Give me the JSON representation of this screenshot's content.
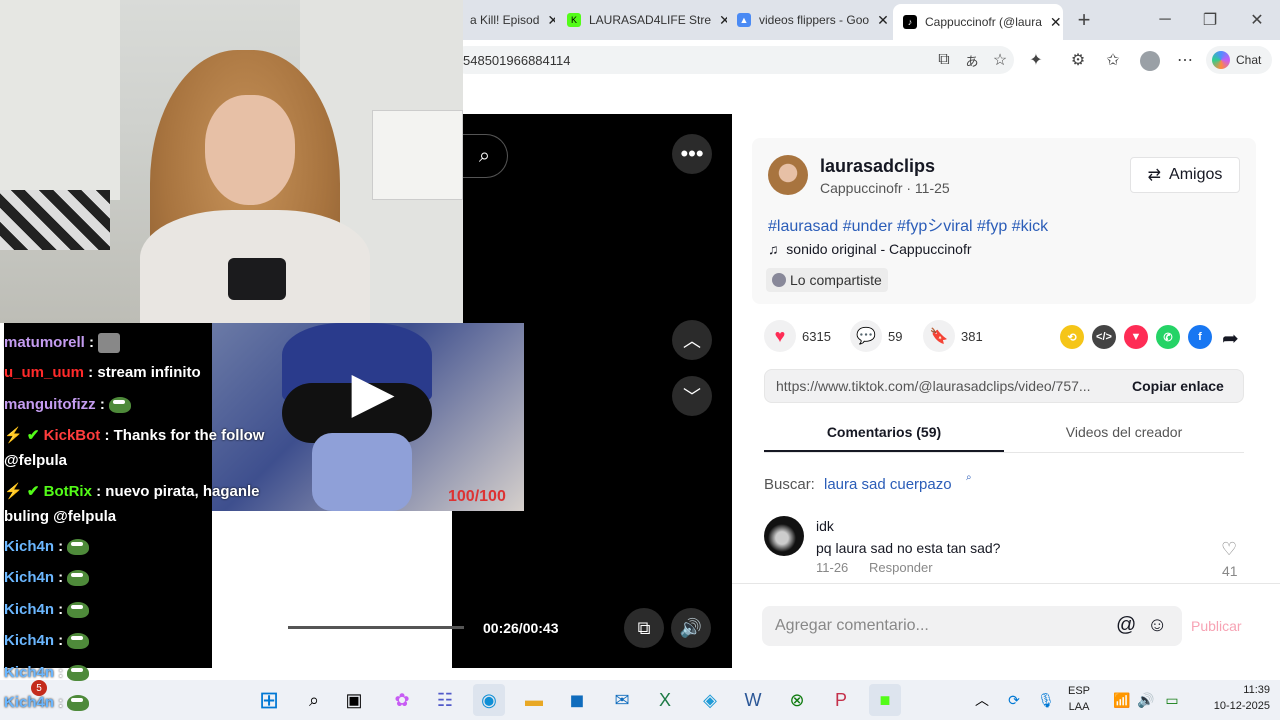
{
  "tabs": [
    {
      "label": "a Kill! Episod",
      "close": "✕"
    },
    {
      "label": "LAURASAD4LIFE Stre",
      "close": "✕"
    },
    {
      "label": "videos flippers - Goo",
      "close": "✕"
    },
    {
      "label": "Cappuccinofr (@laura",
      "close": "✕"
    }
  ],
  "browser": {
    "url": "548501966884114",
    "chat_label": "Chat",
    "new_tab": "+"
  },
  "post": {
    "username": "laurasadclips",
    "subline": "Cappuccinofr · 11-25",
    "friends_button": "Amigos",
    "hashtags": "#laurasad #under #fypシviral #fyp #kick",
    "sound": "sonido original - Cappuccinofr",
    "shared": "Lo compartiste",
    "likes": "6315",
    "comments": "59",
    "saves": "381",
    "link": "https://www.tiktok.com/@laurasadclips/video/757...",
    "copy_link": "Copiar enlace",
    "tab_comments": "Comentarios (59)",
    "tab_creator": "Videos del creador",
    "search_prefix": "Buscar:",
    "search_term": "laura sad cuerpazo",
    "comment": {
      "user": "idk",
      "text": "pq laura sad no esta tan sad?",
      "date": "11-26",
      "reply": "Responder",
      "likes": "41"
    },
    "add_comment_placeholder": "Agregar comentario...",
    "publish": "Publicar"
  },
  "video": {
    "time": "00:26/00:43",
    "progress": 0.6,
    "overlay_counter": "100/100"
  },
  "chat": [
    {
      "user": "matumorell",
      "text": "",
      "color": "#c49cf0",
      "emote": "avatar"
    },
    {
      "user": "u_um_uum",
      "text": "stream infinito",
      "color": "#ff2a2a"
    },
    {
      "user": "manguitofizz",
      "text": "",
      "color": "#c49cf0",
      "emote": "pepe"
    },
    {
      "user": "KickBot",
      "text": "Thanks for the follow",
      "color": "#ff3d3d",
      "text2": "@felpula"
    },
    {
      "user": "BotRix",
      "text": "nuevo pirata, haganle",
      "color": "#53fc18",
      "text2": "buling @felpula"
    },
    {
      "user": "Kich4n",
      "text": "",
      "color": "#6bb7ff",
      "emote": "pepe"
    },
    {
      "user": "Kich4n",
      "text": "",
      "color": "#6bb7ff",
      "emote": "pepe"
    },
    {
      "user": "Kich4n",
      "text": "",
      "color": "#6bb7ff",
      "emote": "pepe"
    },
    {
      "user": "Kich4n",
      "text": "",
      "color": "#6bb7ff",
      "emote": "pepe"
    },
    {
      "user": "Kich4n",
      "text": "",
      "color": "#6bb7ff",
      "emote": "pepe"
    },
    {
      "user": "Kich4n",
      "text": "",
      "color": "#6bb7ff",
      "emote": "pepe"
    }
  ],
  "taskbar": {
    "lang1": "ESP",
    "lang2": "LAA",
    "time": "11:39",
    "date": "10-12-2025",
    "badge": "5"
  },
  "colors": {
    "accent": "#fe2c55",
    "link": "#2b5db8",
    "tabbar": "#dfe3ea"
  }
}
